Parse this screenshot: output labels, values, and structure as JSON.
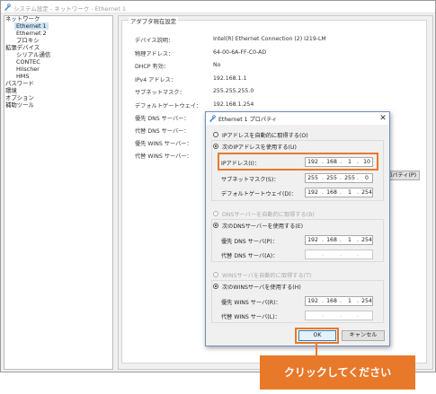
{
  "window": {
    "title": "システム設定 - ネットワーク - Ethernet 1",
    "icon": "settings-app-icon"
  },
  "tree": {
    "items": [
      {
        "label": "ネットワーク"
      },
      {
        "label": "Ethernet 1",
        "selected": true
      },
      {
        "label": "Ethernet 2"
      },
      {
        "label": "プロキシ"
      },
      {
        "label": "拡張デバイス"
      },
      {
        "label": "シリアル通信"
      },
      {
        "label": "CONTEC"
      },
      {
        "label": "Hilscher"
      },
      {
        "label": "HMS"
      },
      {
        "label": "パスワード"
      },
      {
        "label": "環境"
      },
      {
        "label": "オプション"
      },
      {
        "label": "補助ツール"
      }
    ]
  },
  "adapter": {
    "group_title": "アダプタ現在設定",
    "rows": [
      {
        "label": "デバイス説明：",
        "value": "Intel(R) Ethernet Connection (2) I219-LM"
      },
      {
        "label": "物理アドレス：",
        "value": "64-00-6A-FF-C0-AD"
      },
      {
        "label": "DHCP 有効：",
        "value": "No"
      },
      {
        "label": "IPv4 アドレス：",
        "value": "192.168.1.1"
      },
      {
        "label": "サブネットマスク：",
        "value": "255.255.255.0"
      },
      {
        "label": "デフォルトゲートウェイ：",
        "value": "192.168.1.254"
      },
      {
        "label": "優先 DNS サーバー：",
        "value": ""
      },
      {
        "label": "代替 DNS サーバー：",
        "value": ""
      },
      {
        "label": "優先 WINS サーバー：",
        "value": ""
      },
      {
        "label": "代替 WINS サーバー：",
        "value": ""
      }
    ],
    "properties_button_partial": "ロパティ(P)"
  },
  "dialog": {
    "title": "Ethernet 1 プロパティ",
    "close_glyph": "✕",
    "ip_auto": "IPアドレスを自動的に取得する(O)",
    "ip_manual": "次のIPアドレスを使用する(U)",
    "ip_fields": [
      {
        "label": "IPアドレス(I)：",
        "octets": [
          "192",
          "168",
          "1",
          "10"
        ]
      },
      {
        "label": "サブネットマスク(S)：",
        "octets": [
          "255",
          "255",
          "255",
          "0"
        ]
      },
      {
        "label": "デフォルトゲートウェイ(D)：",
        "octets": [
          "192",
          "168",
          "1",
          "254"
        ]
      }
    ],
    "dns_auto": "DNSサーバーを自動的に取得する(B)",
    "dns_manual": "次のDNSサーバーを使用する(E)",
    "dns_fields": [
      {
        "label": "優先 DNS サーバ(P)：",
        "octets": [
          "192",
          "168",
          "1",
          "254"
        ]
      },
      {
        "label": "代替 DNS サーバ(A)：",
        "octets": [
          "",
          "",
          "",
          ""
        ]
      }
    ],
    "wins_auto": "WINSサーバを自動的に取得する(T)",
    "wins_manual": "次のWINSサーバを使用する(H)",
    "wins_fields": [
      {
        "label": "優先 WINS サーバ(R)：",
        "octets": [
          "192",
          "168",
          "1",
          "254"
        ]
      },
      {
        "label": "代替 WINS サーバ(L)：",
        "octets": [
          "",
          "",
          "",
          ""
        ]
      }
    ],
    "ok_label": "OK",
    "cancel_label": "キャンセル"
  },
  "callout": {
    "text": "クリックしてください",
    "color": "#e8792a"
  }
}
